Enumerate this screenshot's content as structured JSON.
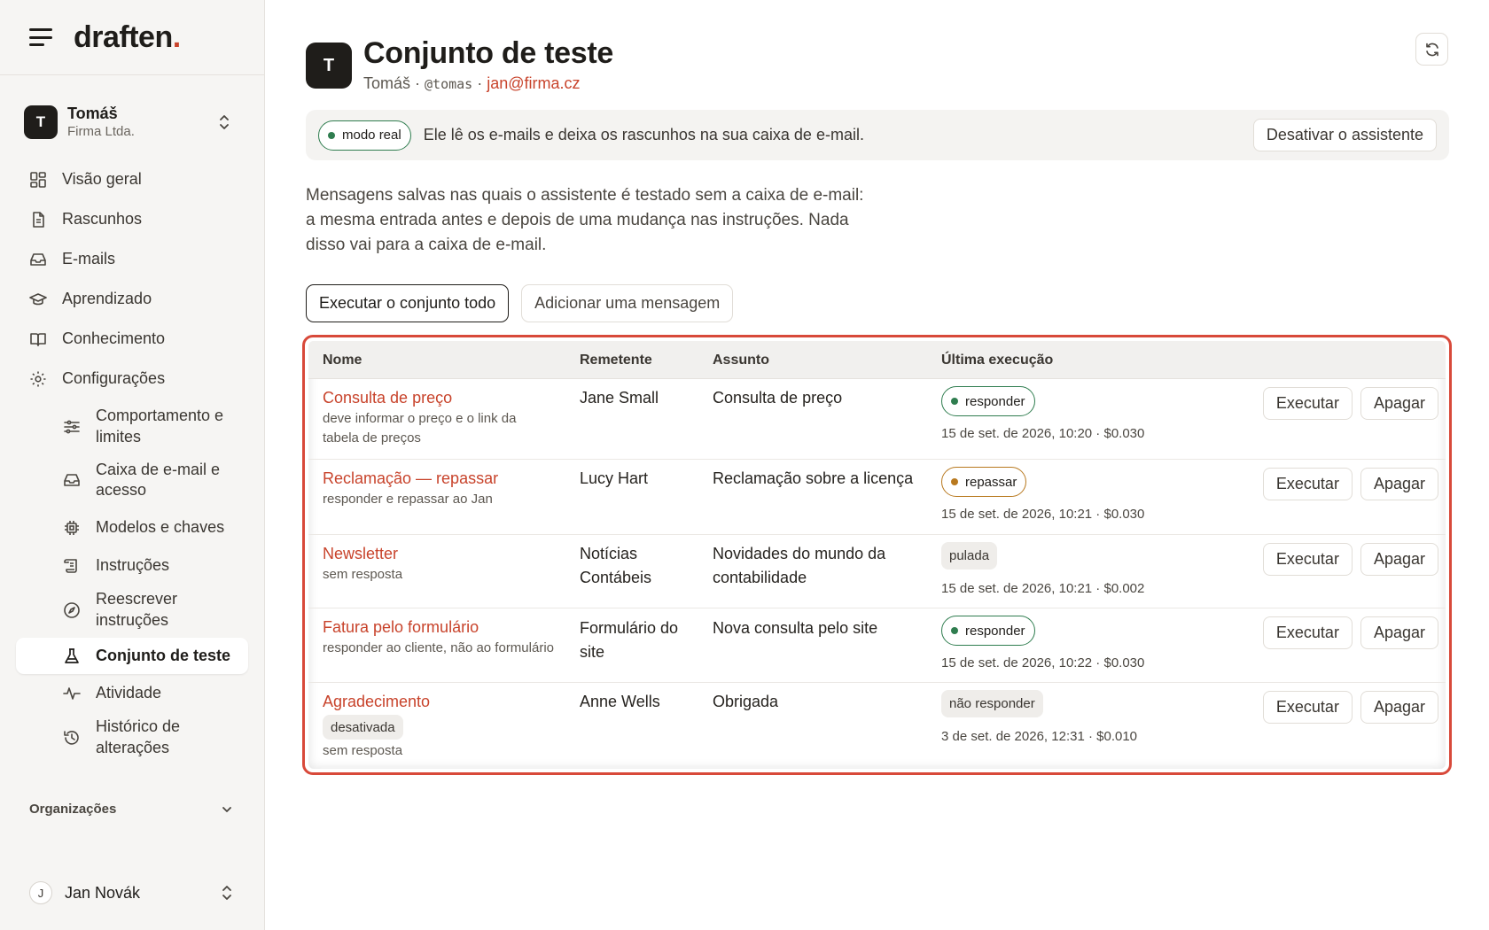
{
  "app": {
    "logo": "draften",
    "logo_dot": "."
  },
  "workspace": {
    "avatar": "T",
    "name": "Tomáš",
    "org": "Firma Ltda."
  },
  "nav": {
    "items": [
      {
        "label": "Visão geral",
        "icon": "dashboard-icon"
      },
      {
        "label": "Rascunhos",
        "icon": "document-icon"
      },
      {
        "label": "E-mails",
        "icon": "inbox-icon"
      },
      {
        "label": "Aprendizado",
        "icon": "graduation-cap-icon"
      },
      {
        "label": "Conhecimento",
        "icon": "book-icon"
      },
      {
        "label": "Configurações",
        "icon": "gear-icon"
      }
    ],
    "sub_items": [
      {
        "label": "Comportamento e limites",
        "icon": "sliders-icon"
      },
      {
        "label": "Caixa de e-mail e acesso",
        "icon": "inbox-icon"
      },
      {
        "label": "Modelos e chaves",
        "icon": "chip-icon"
      },
      {
        "label": "Instruções",
        "icon": "scroll-icon"
      },
      {
        "label": "Reescrever instruções",
        "icon": "compass-icon"
      },
      {
        "label": "Conjunto de teste",
        "icon": "flask-icon"
      },
      {
        "label": "Atividade",
        "icon": "activity-icon"
      },
      {
        "label": "Histórico de alterações",
        "icon": "history-icon"
      }
    ],
    "organizations_label": "Organizações"
  },
  "user": {
    "avatar": "J",
    "name": "Jan Novák"
  },
  "header": {
    "avatar": "T",
    "title": "Conjunto de teste",
    "owner": "Tomáš",
    "handle": "@tomas",
    "email": "jan@firma.cz",
    "separator": " · "
  },
  "banner": {
    "mode": "modo real",
    "text": "Ele lê os e-mails e deixa os rascunhos na sua caixa de e-mail.",
    "button": "Desativar o assistente"
  },
  "description": "Mensagens salvas nas quais o assistente é testado sem a caixa de e-mail: a mesma entrada antes e depois de uma mudança nas instruções. Nada disso vai para a caixa de e-mail.",
  "actions": {
    "run_all": "Executar o conjunto todo",
    "add_message": "Adicionar uma mensagem"
  },
  "table": {
    "columns": [
      "Nome",
      "Remetente",
      "Assunto",
      "Última execução"
    ],
    "run_label": "Executar",
    "delete_label": "Apagar",
    "rows": [
      {
        "name": "Consulta de preço",
        "note": "deve informar o preço e o link da tabela de preços",
        "tag": "",
        "sender": "Jane Small",
        "subject": "Consulta de preço",
        "result": "responder",
        "result_style": "green",
        "last_run": "15 de set. de 2026, 10:20 · $0.030"
      },
      {
        "name": "Reclamação — repassar",
        "note": "responder e repassar ao Jan",
        "tag": "",
        "sender": "Lucy Hart",
        "subject": "Reclamação sobre a licença",
        "result": "repassar",
        "result_style": "amber",
        "last_run": "15 de set. de 2026, 10:21 · $0.030"
      },
      {
        "name": "Newsletter",
        "note": "sem resposta",
        "tag": "",
        "sender": "Notícias Contábeis",
        "subject": "Novidades do mundo da contabilidade",
        "result": "pulada",
        "result_style": "plain",
        "last_run": "15 de set. de 2026, 10:21 · $0.002"
      },
      {
        "name": "Fatura pelo formulário",
        "note": "responder ao cliente, não ao formulário",
        "tag": "",
        "sender": "Formulário do site",
        "subject": "Nova consulta pelo site",
        "result": "responder",
        "result_style": "green",
        "last_run": "15 de set. de 2026, 10:22 · $0.030"
      },
      {
        "name": "Agradecimento",
        "note": "sem resposta",
        "tag": "desativada",
        "sender": "Anne Wells",
        "subject": "Obrigada",
        "result": "não responder",
        "result_style": "plain",
        "last_run": "3 de set. de 2026, 12:31 · $0.010"
      }
    ]
  },
  "colors": {
    "accent": "#c8432b",
    "highlight_border": "#d8493a",
    "green": "#2f7d4f",
    "amber": "#b8791f"
  }
}
